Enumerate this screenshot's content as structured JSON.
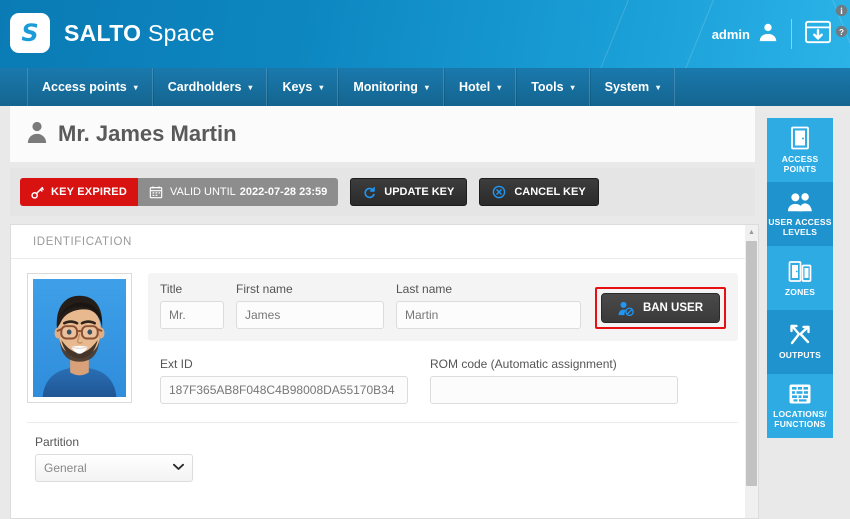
{
  "header": {
    "brand_thin": "S",
    "brand_name_part1": "SALTO",
    "brand_name_part2": "Space",
    "logo_letter": "S",
    "admin_label": "admin",
    "user_icon": "user-icon",
    "download_icon": "download-window-icon",
    "info_icon": "info-icon",
    "help_icon": "help-icon",
    "bg_color": "#0d86c0",
    "accent_color": "#2bb3e8"
  },
  "nav": {
    "items": [
      {
        "label": "Access points",
        "caret": "▾"
      },
      {
        "label": "Cardholders",
        "caret": "▾"
      },
      {
        "label": "Keys",
        "caret": "▾"
      },
      {
        "label": "Monitoring",
        "caret": "▾"
      },
      {
        "label": "Hotel",
        "caret": "▾"
      },
      {
        "label": "Tools",
        "caret": "▾"
      },
      {
        "label": "System",
        "caret": "▾"
      }
    ],
    "bg_color": "#14658f"
  },
  "page": {
    "title": "Mr. James Martin",
    "title_icon": "person-icon"
  },
  "keybar": {
    "status_label": "KEY EXPIRED",
    "status_icon": "key-icon",
    "status_color": "#d81111",
    "valid_until_label": "VALID UNTIL",
    "valid_until_value": "2022-07-28 23:59",
    "valid_icon": "calendar-icon",
    "valid_color": "#8d8d8d",
    "update_key_label": "UPDATE KEY",
    "update_key_icon": "refresh-icon",
    "cancel_key_label": "CANCEL KEY",
    "cancel_key_icon": "cancel-circle-icon"
  },
  "identification": {
    "section_title": "IDENTIFICATION",
    "photo_alt": "cardholder-photo",
    "fields": {
      "title": {
        "label": "Title",
        "value": "Mr."
      },
      "first_name": {
        "label": "First name",
        "value": "James"
      },
      "last_name": {
        "label": "Last name",
        "value": "Martin"
      },
      "ext_id": {
        "label": "Ext ID",
        "value": "187F365AB8F048C4B98008DA55170B34"
      },
      "rom_code": {
        "label": "ROM code (Automatic assignment)",
        "value": ""
      }
    },
    "ban_user": {
      "label": "BAN USER",
      "icon": "ban-user-icon",
      "highlight_color": "#e81010"
    },
    "partition": {
      "label": "Partition",
      "value": "General",
      "caret": "⌄"
    }
  },
  "sidebar": {
    "items": [
      {
        "label": "ACCESS POINTS",
        "icon": "door-icon",
        "tone": "light"
      },
      {
        "label": "USER ACCESS LEVELS",
        "icon": "users-icon",
        "tone": "dark"
      },
      {
        "label": "ZONES",
        "icon": "zones-icon",
        "tone": "light"
      },
      {
        "label": "OUTPUTS",
        "icon": "outputs-icon",
        "tone": "dark"
      },
      {
        "label": "LOCATIONS/ FUNCTIONS",
        "icon": "locations-icon",
        "tone": "light"
      }
    ],
    "light_color": "#2fabe4",
    "dark_color": "#1f93cd"
  },
  "scrollbar": {
    "up_arrow": "▲"
  }
}
